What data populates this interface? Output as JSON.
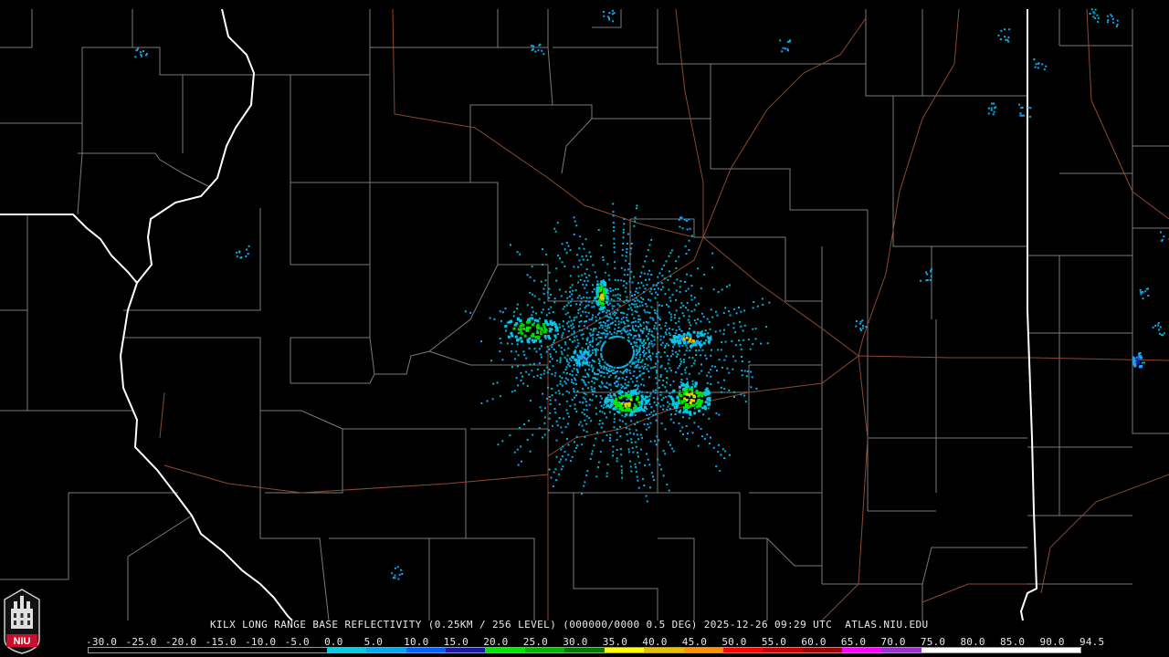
{
  "product": {
    "caption": "KILX LONG RANGE BASE REFLECTIVITY (0.25KM / 256 LEVEL) (000000/0000 0.5 DEG) 2025-12-26 09:29 UTC  ATLAS.NIU.EDU"
  },
  "logo": {
    "text": "NIU",
    "color": "#c8102e"
  },
  "colorscale": {
    "labels": [
      "-30.0",
      "-25.0",
      "-20.0",
      "-15.0",
      "-10.0",
      "-5.0",
      "0.0",
      "5.0",
      "10.0",
      "15.0",
      "20.0",
      "25.0",
      "30.0",
      "35.0",
      "40.0",
      "45.0",
      "50.0",
      "55.0",
      "60.0",
      "65.0",
      "70.0",
      "75.0",
      "80.0",
      "85.0",
      "90.0",
      "94.5"
    ],
    "colors": [
      "#000000",
      "#000000",
      "#000000",
      "#000000",
      "#000000",
      "#000000",
      "#00ccdd",
      "#00a8f0",
      "#0060ff",
      "#1a1aa0",
      "#00e600",
      "#00b400",
      "#007800",
      "#ffff00",
      "#e6c000",
      "#ff9000",
      "#ff0000",
      "#c80000",
      "#a00000",
      "#ff00ff",
      "#9933cc",
      "#ffffff",
      "#ffffff",
      "#ffffff",
      "#ffffff"
    ]
  },
  "map_colors": {
    "background": "#000000",
    "county_lines": "#7a7a7a",
    "state_lines": "#ffffff",
    "highways": "#8c4a2e"
  }
}
